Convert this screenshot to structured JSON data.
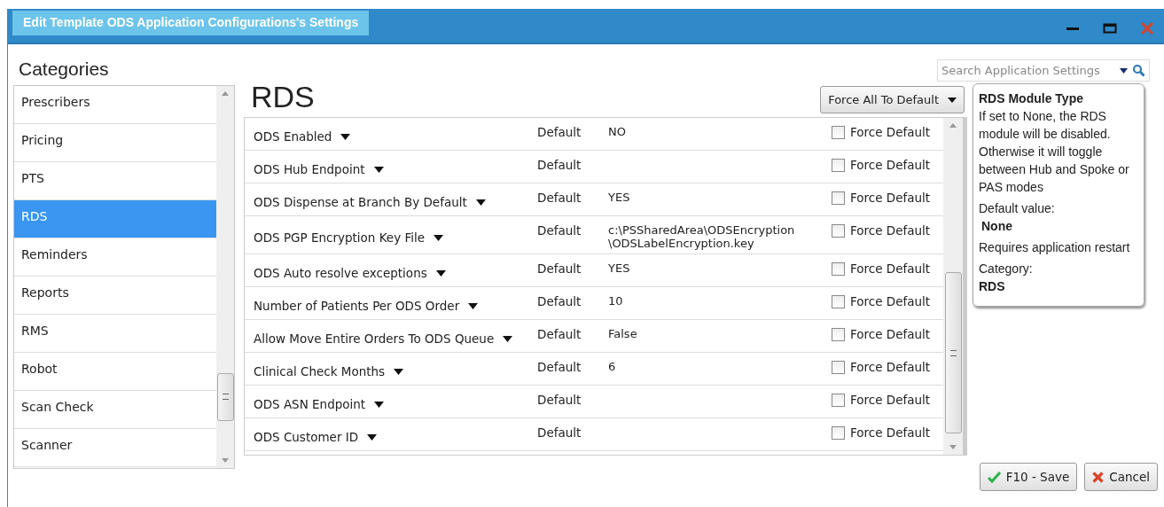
{
  "window": {
    "title": "Edit Template ODS Application Configurations's Settings"
  },
  "categories": {
    "heading": "Categories",
    "items": [
      {
        "label": "Prescribers",
        "selected": false
      },
      {
        "label": "Pricing",
        "selected": false
      },
      {
        "label": "PTS",
        "selected": false
      },
      {
        "label": "RDS",
        "selected": true
      },
      {
        "label": "Reminders",
        "selected": false
      },
      {
        "label": "Reports",
        "selected": false
      },
      {
        "label": "RMS",
        "selected": false
      },
      {
        "label": "Robot",
        "selected": false
      },
      {
        "label": "Scan Check",
        "selected": false
      },
      {
        "label": "Scanner",
        "selected": false
      }
    ]
  },
  "search": {
    "placeholder": "Search Application Settings"
  },
  "section_title": "RDS",
  "force_all_button": "Force All To Default",
  "settings": [
    {
      "name": "ODS Enabled",
      "source": "Default",
      "value": [
        "NO"
      ],
      "force_label": "Force Default",
      "checked": false
    },
    {
      "name": "ODS Hub Endpoint",
      "source": "Default",
      "force_label": "Force Default",
      "checked": false
    },
    {
      "name": "ODS Dispense at Branch By Default",
      "source": "Default",
      "value": [
        "YES"
      ],
      "force_label": "Force Default",
      "checked": false
    },
    {
      "name": "ODS PGP Encryption Key File",
      "source": "Default",
      "value": [
        "c:\\PSSharedArea\\ODSEncryption",
        "\\ODSLabelEncryption.key"
      ],
      "force_label": "Force Default",
      "checked": false
    },
    {
      "name": "ODS Auto resolve exceptions",
      "source": "Default",
      "value": [
        "YES"
      ],
      "force_label": "Force Default",
      "checked": false
    },
    {
      "name": "Number of Patients Per ODS Order",
      "source": "Default",
      "value": [
        "10"
      ],
      "force_label": "Force Default",
      "checked": false
    },
    {
      "name": "Allow Move Entire Orders To ODS Queue",
      "source": "Default",
      "value": [
        "False"
      ],
      "force_label": "Force Default",
      "checked": false
    },
    {
      "name": "Clinical Check Months",
      "source": "Default",
      "value": [
        "6"
      ],
      "force_label": "Force Default",
      "checked": false
    },
    {
      "name": "ODS ASN Endpoint",
      "source": "Default",
      "force_label": "Force Default",
      "checked": false
    },
    {
      "name": "ODS Customer ID",
      "source": "Default",
      "force_label": "Force Default",
      "checked": false
    }
  ],
  "info": {
    "title": "RDS Module Type",
    "description": "If set to None, the RDS module will be disabled. Otherwise it will toggle between Hub and Spoke or PAS modes",
    "default_label": "Default value:",
    "default_value": "None",
    "restart_note": "Requires application restart",
    "category_label": "Category:",
    "category_value": "RDS"
  },
  "buttons": [
    {
      "kind": "save",
      "label": "F10 - Save"
    },
    {
      "kind": "cancel",
      "label": "Cancel"
    }
  ]
}
